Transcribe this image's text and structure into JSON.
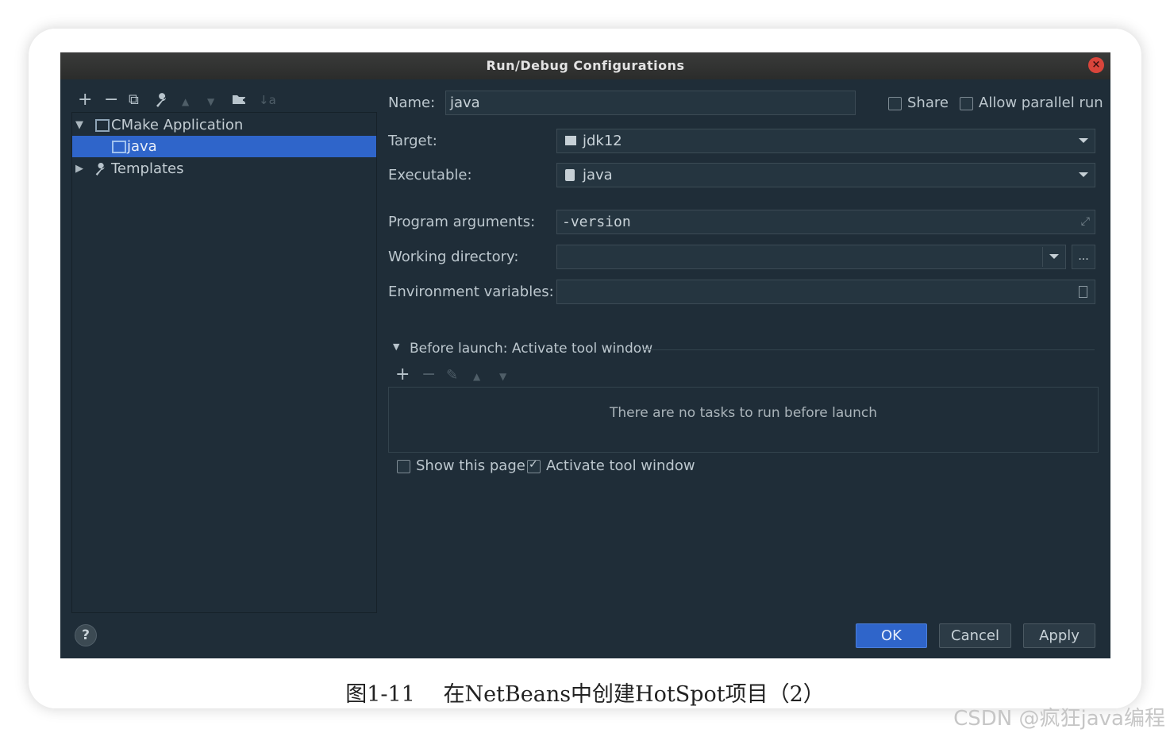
{
  "window": {
    "title": "Run/Debug Configurations"
  },
  "toolbar": {
    "icons": [
      "add-icon",
      "remove-icon",
      "copy-icon",
      "wrench-icon",
      "move-up-icon",
      "move-down-icon",
      "folder-icon",
      "sort-icon"
    ],
    "glyphs": {
      "add": "+",
      "remove": "−",
      "copy": "⧉",
      "wrench": "🔧",
      "up": "▲",
      "down": "▼",
      "folder": "📂",
      "sort": "↓a"
    }
  },
  "tree": {
    "items": [
      {
        "label": "CMake Application",
        "expanded": true
      },
      {
        "label": "java",
        "selected": true
      },
      {
        "label": "Templates",
        "expanded": false
      }
    ]
  },
  "form": {
    "name_label": "Name:",
    "name_value": "java",
    "share_label": "Share",
    "parallel_label": "Allow parallel run",
    "target_label": "Target:",
    "target_value": "jdk12",
    "executable_label": "Executable:",
    "executable_value": "java",
    "args_label": "Program arguments:",
    "args_value": "-version",
    "workdir_label": "Working directory:",
    "workdir_value": "",
    "workdir_browse": "...",
    "env_label": "Environment variables:",
    "env_value": ""
  },
  "before_launch": {
    "header": "Before launch: Activate tool window",
    "empty_text": "There are no tasks to run before launch",
    "show_page_label": "Show this page",
    "show_page_checked": false,
    "activate_label": "Activate tool window",
    "activate_checked": true
  },
  "buttons": {
    "help": "?",
    "ok": "OK",
    "cancel": "Cancel",
    "apply": "Apply"
  },
  "caption": "图1-11　 在NetBeans中创建HotSpot项目（2）",
  "watermark": "CSDN @疯狂java编程",
  "colors": {
    "dialog_bg": "#1f2d38",
    "selection": "#2f65ca",
    "close": "#d9453b"
  }
}
